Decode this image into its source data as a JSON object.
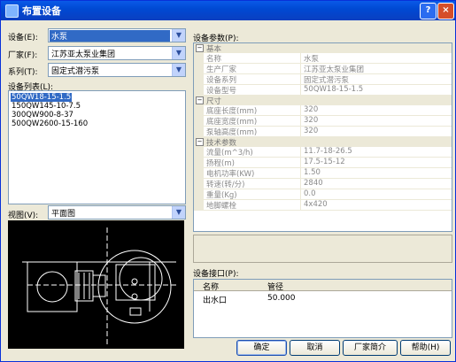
{
  "window": {
    "title": "布置设备",
    "help_label": "?",
    "close_label": "×"
  },
  "left": {
    "device_label": "设备(E):",
    "device_value": "水泵",
    "maker_label": "厂家(F):",
    "maker_value": "江苏亚太泵业集团",
    "series_label": "系列(T):",
    "series_value": "固定式潜污泵",
    "list_label": "设备列表(L):",
    "list_items": [
      "50QW18-15-1.5",
      "150QW145-10-7.5",
      "300QW900-8-37",
      "500QW2600-15-160"
    ],
    "selected_index": 0,
    "view_label": "视图(V):",
    "view_value": "平面图"
  },
  "params": {
    "label": "设备参数(P):",
    "categories": [
      {
        "name": "基本",
        "toggle": "⊟",
        "rows": [
          {
            "name": "名称",
            "value": "水泵"
          },
          {
            "name": "生产厂家",
            "value": "江苏亚太泵业集团"
          },
          {
            "name": "设备系列",
            "value": "固定式潜污泵"
          },
          {
            "name": "设备型号",
            "value": "50QW18-15-1.5"
          }
        ]
      },
      {
        "name": "尺寸",
        "toggle": "⊟",
        "rows": [
          {
            "name": "底座长度(mm)",
            "value": "320"
          },
          {
            "name": "底座宽度(mm)",
            "value": "320"
          },
          {
            "name": "泵轴高度(mm)",
            "value": "320"
          }
        ]
      },
      {
        "name": "技术参数",
        "toggle": "⊟",
        "rows": [
          {
            "name": "流量(m^3/h)",
            "value": "11.7-18-26.5"
          },
          {
            "name": "扬程(m)",
            "value": "17.5-15-12"
          },
          {
            "name": "电机功率(KW)",
            "value": "1.50"
          },
          {
            "name": "转速(转/分)",
            "value": "2840"
          },
          {
            "name": "重量(Kg)",
            "value": "0.0"
          },
          {
            "name": "地脚螺栓",
            "value": "4x420"
          }
        ]
      }
    ]
  },
  "interface": {
    "label": "设备接口(P):",
    "headers": [
      "名称",
      "管径"
    ],
    "rows": [
      {
        "name": "出水口",
        "diameter": "50.000"
      }
    ]
  },
  "buttons": {
    "ok": "确定",
    "cancel": "取消",
    "maker_intro": "厂家简介",
    "help": "帮助(H)"
  }
}
